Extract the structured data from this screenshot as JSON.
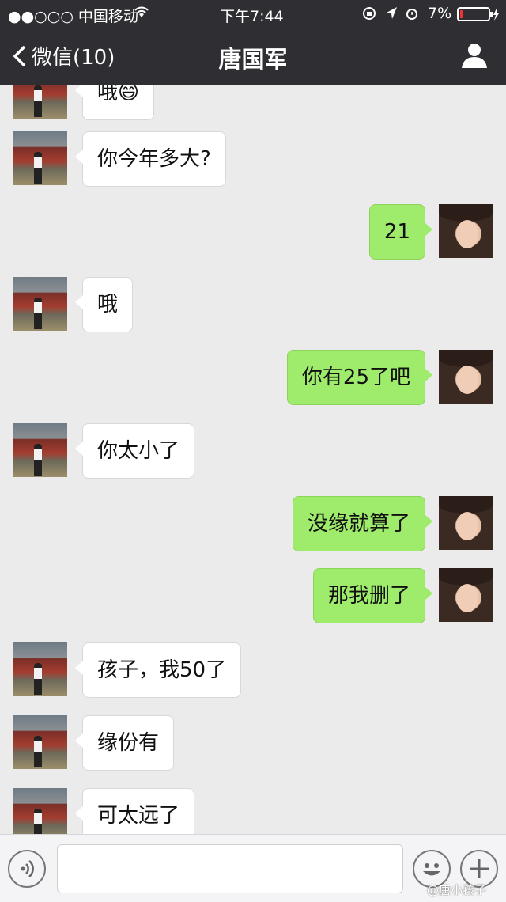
{
  "status_bar": {
    "carrier": "●●○○○ 中国移动",
    "time": "下午7:44",
    "battery": "7%"
  },
  "nav": {
    "back_label": "微信(10)",
    "title": "唐国军"
  },
  "messages": [
    {
      "side": "left",
      "text": "哦😄"
    },
    {
      "side": "left",
      "text": "你今年多大?"
    },
    {
      "side": "right",
      "text": "21"
    },
    {
      "side": "left",
      "text": "哦"
    },
    {
      "side": "right",
      "text": "你有25了吧"
    },
    {
      "side": "left",
      "text": "你太小了"
    },
    {
      "side": "right",
      "text": "没缘就算了"
    },
    {
      "side": "right",
      "text": "那我删了"
    },
    {
      "side": "left",
      "text": "孩子，我50了"
    },
    {
      "side": "left",
      "text": "缘份有"
    },
    {
      "side": "left",
      "text": "可太远了"
    }
  ],
  "input_bar": {
    "placeholder": ""
  },
  "watermark": "@唐小孩子",
  "colors": {
    "nav_bg": "#2e2e33",
    "chat_bg": "#ebebeb",
    "sent_bubble": "#9feb6b",
    "received_bubble": "#ffffff"
  }
}
